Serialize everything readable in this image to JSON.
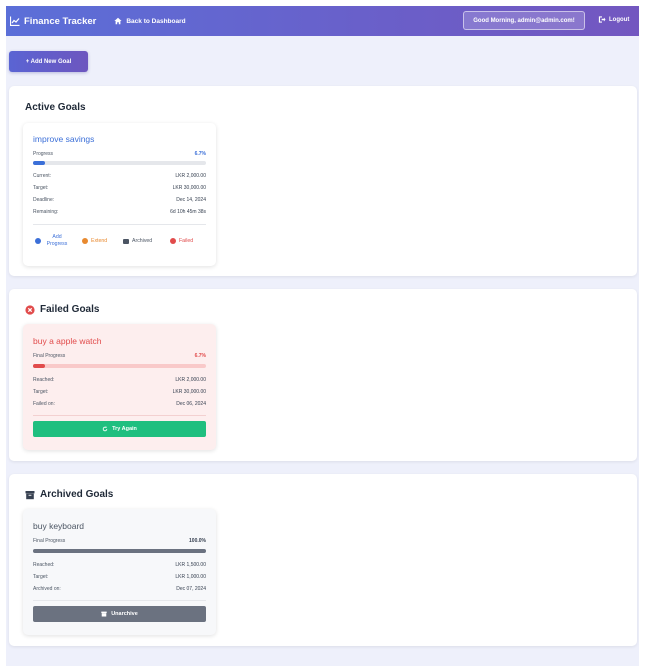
{
  "nav": {
    "brand": "Finance Tracker",
    "back_label": "Back to Dashboard",
    "greeting": "Good Morning, admin@admin.com!",
    "logout_label": "Logout"
  },
  "add_goal_label": "+ Add New Goal",
  "active": {
    "title": "Active Goals",
    "card": {
      "name": "improve savings",
      "progress_label": "Progress",
      "progress_text": "6.7%",
      "progress_value": 0.067,
      "current_label": "Current:",
      "current_value": "LKR 2,000.00",
      "target_label": "Target:",
      "target_value": "LKR 30,000.00",
      "deadline_label": "Deadline:",
      "deadline_value": "Dec 14, 2024",
      "remaining_label": "Remaining:",
      "remaining_value": "6d 10h 45m 38s",
      "actions": {
        "add_progress": "Add Progress",
        "extend": "Extend",
        "archived": "Archived",
        "failed": "Failed"
      }
    }
  },
  "failed": {
    "title": "Failed Goals",
    "card": {
      "name": "buy a apple watch",
      "progress_label": "Final Progress",
      "progress_text": "6.7%",
      "progress_value": 0.067,
      "reached_label": "Reached:",
      "reached_value": "LKR 2,000.00",
      "target_label": "Target:",
      "target_value": "LKR 30,000.00",
      "failed_label": "Failed on:",
      "failed_value": "Dec 06, 2024",
      "try_again_label": "Try Again"
    }
  },
  "archived": {
    "title": "Archived Goals",
    "card": {
      "name": "buy keyboard",
      "progress_label": "Final Progress",
      "progress_text": "100.0%",
      "progress_value": 1.0,
      "reached_label": "Reached:",
      "reached_value": "LKR 1,500.00",
      "target_label": "Target:",
      "target_value": "LKR 1,000.00",
      "archived_label": "Archived on:",
      "archived_value": "Dec 07, 2024",
      "unarchive_label": "Unarchive"
    }
  },
  "colors": {
    "nav_start": "#5b6fd8",
    "nav_end": "#7357c0",
    "active_blue": "#3b6fd8",
    "failed_red": "#e14b4b",
    "archived_gray": "#6b7280",
    "try_again_green": "#1fbf7f",
    "extend_orange": "#e8892f"
  }
}
